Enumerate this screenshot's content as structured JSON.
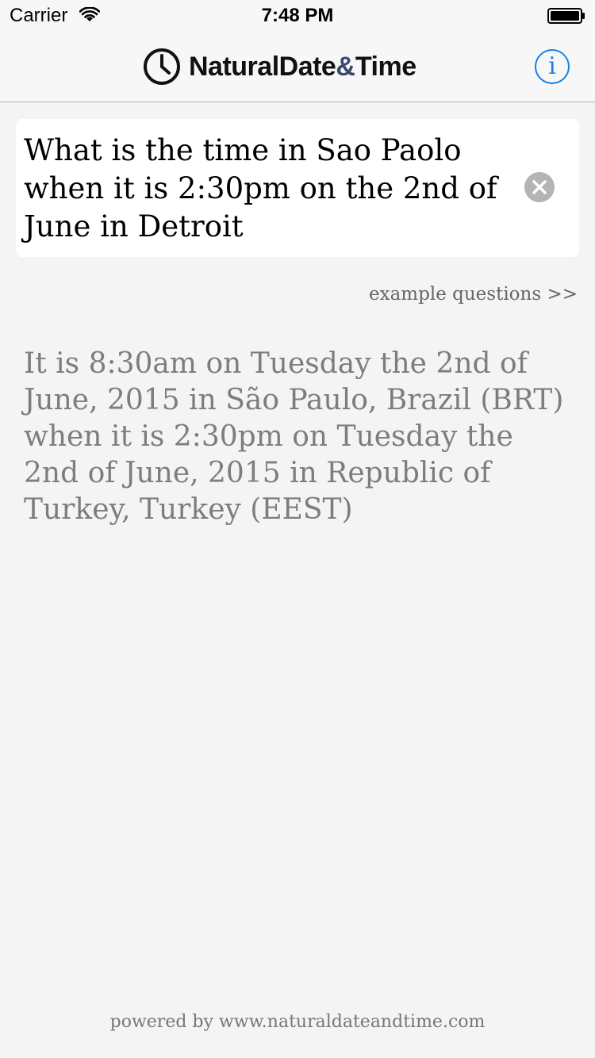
{
  "status_bar": {
    "carrier": "Carrier",
    "time": "7:48 PM"
  },
  "nav": {
    "logo_part1": "NaturalDate",
    "logo_amp": "&",
    "logo_part2": "Time",
    "info_label": "i"
  },
  "query": {
    "text": "What is the time in Sao Paolo when it is 2:30pm on the 2nd of June in Detroit"
  },
  "links": {
    "example_questions": "example questions >>"
  },
  "answer": {
    "text": "It is 8:30am on Tuesday the 2nd of June, 2015 in São Paulo, Brazil (BRT) when it is 2:30pm on Tuesday the 2nd of June, 2015 in Republic of Turkey, Turkey (EEST)"
  },
  "footer": {
    "text": "powered by www.naturaldateandtime.com"
  },
  "icons": {
    "wifi": "wifi-icon",
    "battery": "battery-icon",
    "logo": "clock-icon",
    "clear": "clear-icon",
    "info": "info-icon"
  },
  "colors": {
    "accent": "#1a7ee8",
    "logo_amp": "#3a4a6e",
    "answer_text": "#7d7d7d",
    "background": "#f4f4f4"
  }
}
